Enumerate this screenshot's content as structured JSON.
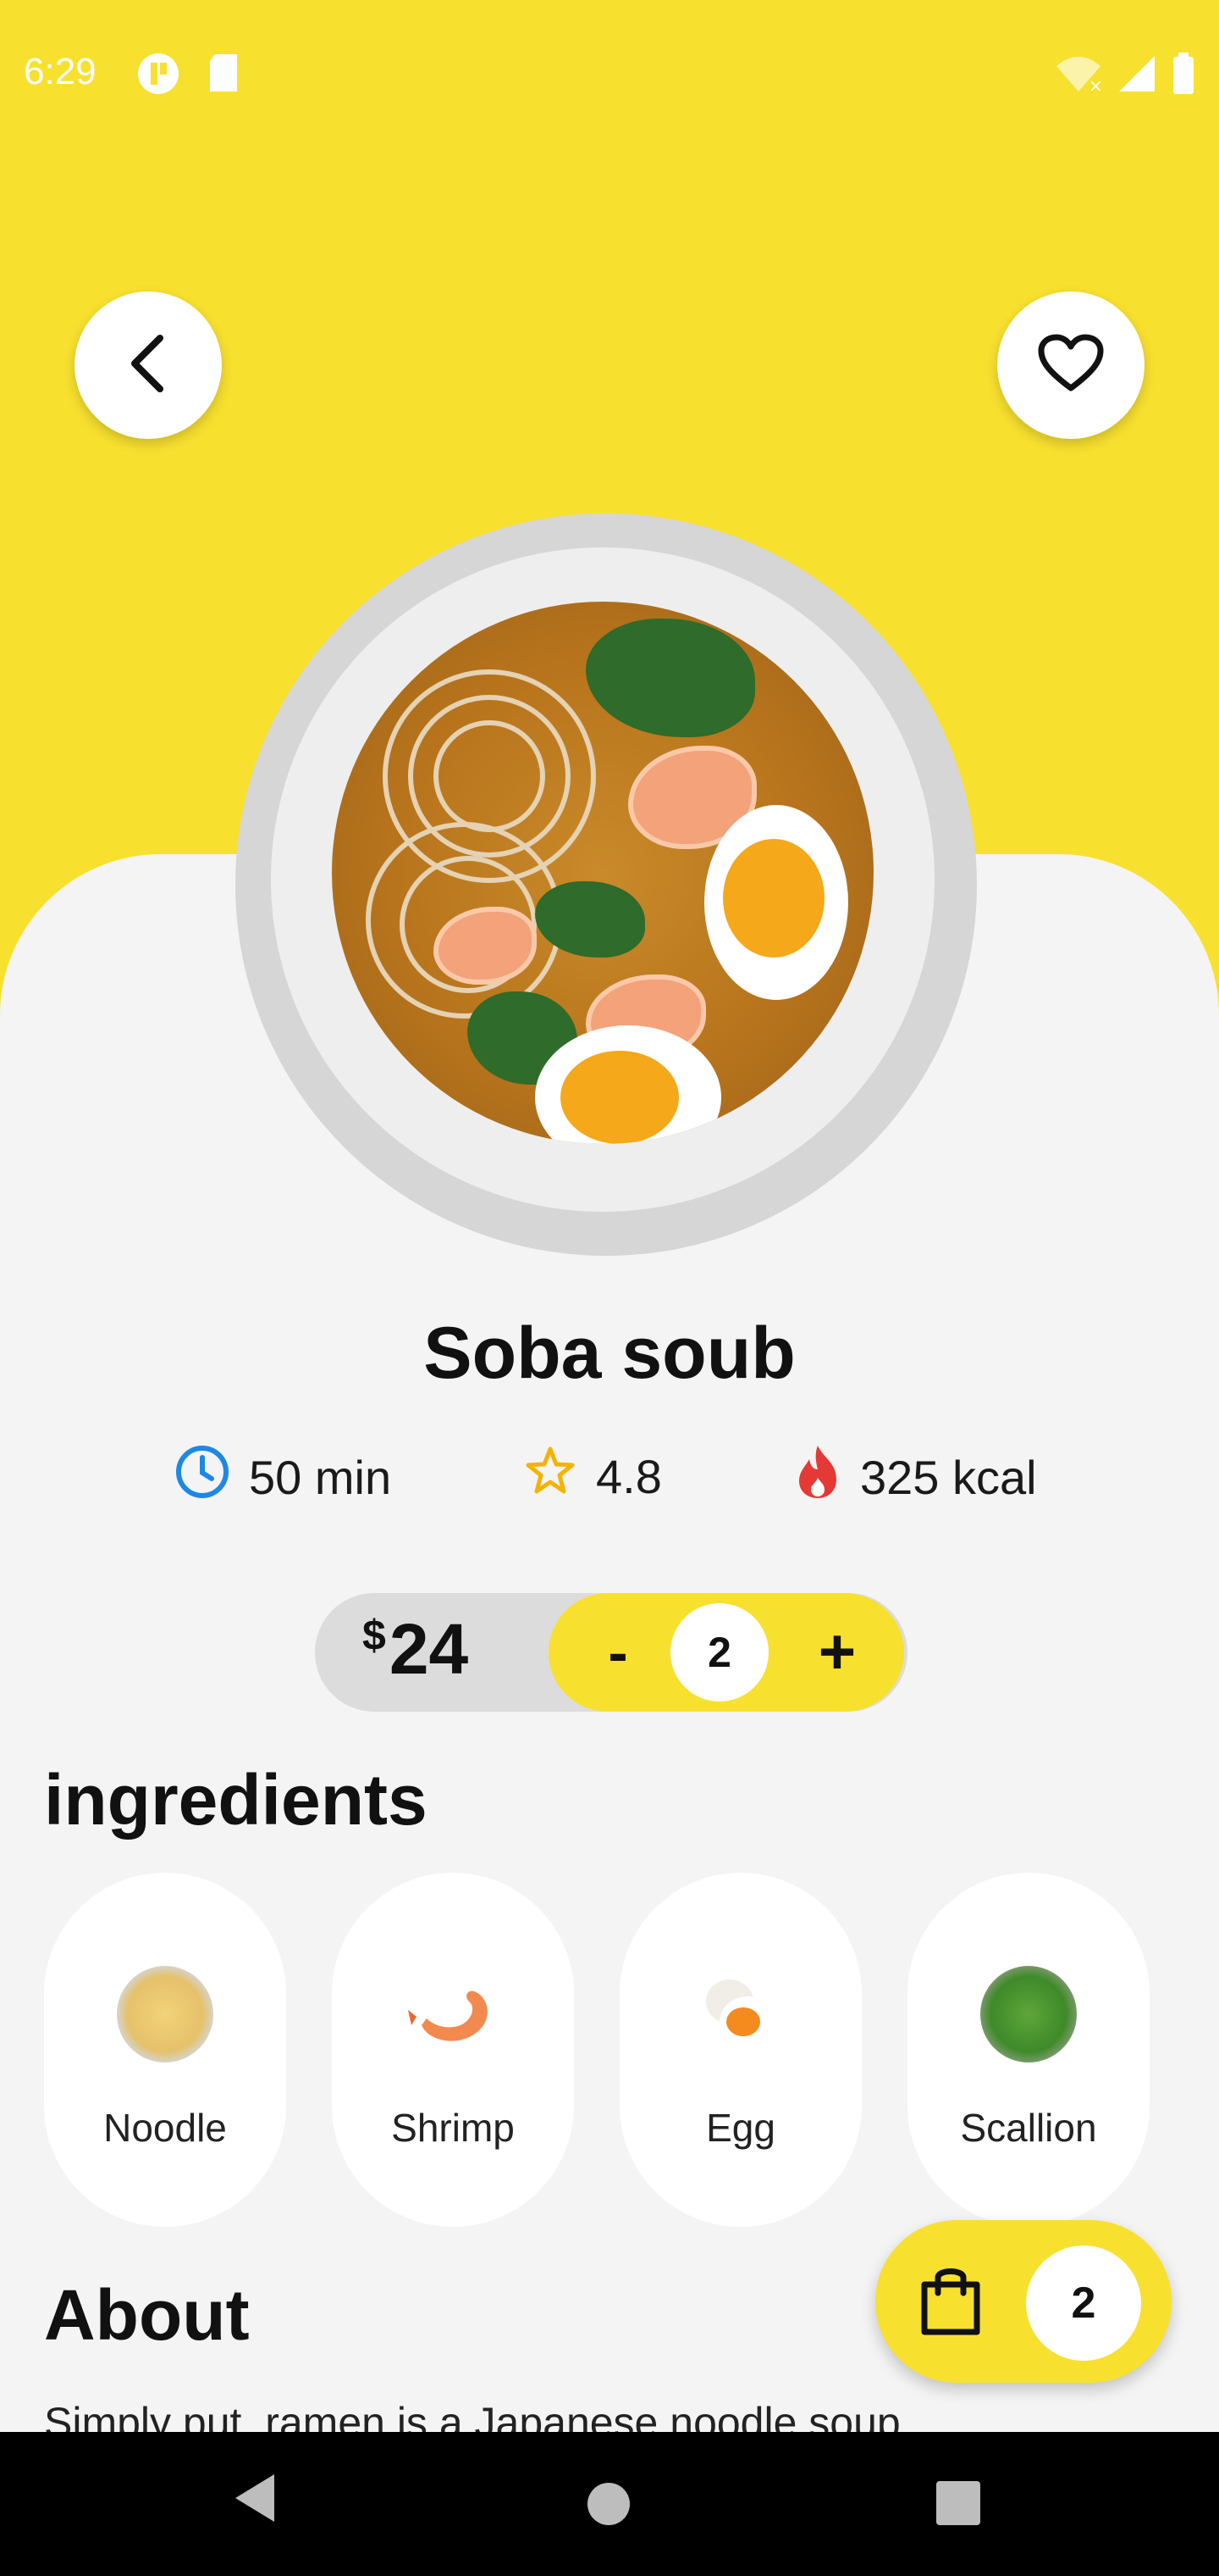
{
  "status_bar": {
    "time": "6:29",
    "left_icons": [
      "app-icon",
      "sd-card-icon"
    ],
    "right_icons": [
      "wifi-off-icon",
      "signal-icon",
      "battery-icon"
    ]
  },
  "header": {
    "back_icon": "chevron-left-icon",
    "favorite_icon": "heart-outline-icon"
  },
  "dish": {
    "name": "Soba soub",
    "stats": [
      {
        "icon": "clock-icon",
        "label": "50 min"
      },
      {
        "icon": "star-icon",
        "label": "4.8"
      },
      {
        "icon": "fire-icon",
        "label": "325 kcal"
      }
    ],
    "currency": "$",
    "price": "24",
    "quantity": "2",
    "minus_label": "-",
    "plus_label": "+"
  },
  "ingredients": {
    "title": "ingredients",
    "items": [
      {
        "label": "Noodle"
      },
      {
        "label": "Shrimp"
      },
      {
        "label": "Egg"
      },
      {
        "label": "Scallion"
      }
    ]
  },
  "about": {
    "title": "About",
    "text": "Simply put, ramen is a Japanese noodle soup"
  },
  "cart": {
    "count": "2",
    "icon": "shopping-bag-icon"
  },
  "colors": {
    "accent": "#f8e02f",
    "background": "#f4f4f4",
    "clock": "#1e88e5",
    "star": "#f5b300",
    "fire": "#e53935"
  }
}
